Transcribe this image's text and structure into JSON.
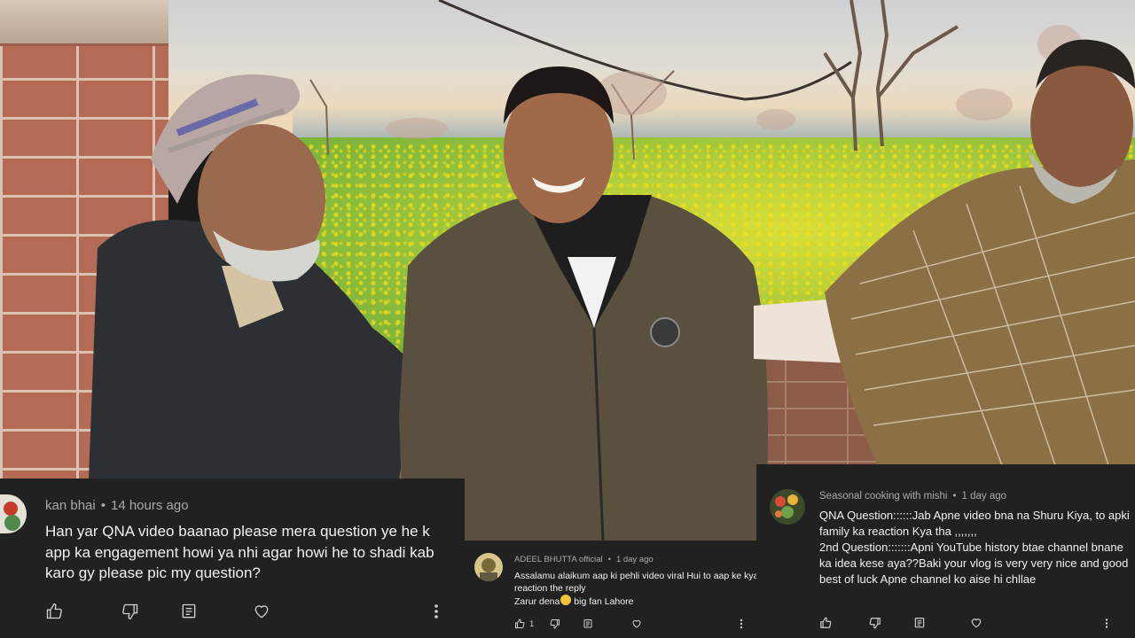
{
  "comments": [
    {
      "author": "kan bhai",
      "time": "14 hours ago",
      "text": "Han yar QNA video baanao please mera question ye he k app ka engagement howi ya nhi agar howi he to shadi kab karo gy please pic my question?",
      "like_count": "",
      "icons": [
        "thumbs-up-icon",
        "thumbs-down-icon",
        "reply-icon",
        "heart-icon",
        "more-vert-icon"
      ]
    },
    {
      "author": "ADEEL BHUTTA official",
      "time": "1 day ago",
      "text_line1": "Assalamu alaikum aap ki pehli video viral Hui to aap ke kya reaction the reply",
      "text_line2": "Zarur dena",
      "text_line3": " big fan Lahore",
      "like_count": "1",
      "icons": [
        "thumbs-up-icon",
        "thumbs-down-icon",
        "reply-icon",
        "heart-icon",
        "more-vert-icon"
      ]
    },
    {
      "author": "Seasonal cooking with mishi",
      "time": "1 day ago",
      "text_line1": "QNA Question::::::Jab Apne video bna na Shuru Kiya, to apki family ka reaction Kya tha ,,,,,,,",
      "text_line2": "2nd Question:::::::Apni YouTube history btae channel bnane ka idea kese aya??Baki your vlog is very very nice and good best of luck Apne channel ko aise hi chllae",
      "like_count": "",
      "icons": [
        "thumbs-up-icon",
        "thumbs-down-icon",
        "reply-icon",
        "heart-icon",
        "more-vert-icon"
      ]
    }
  ],
  "colors": {
    "card_bg": "#212121",
    "text": "#f1f1f1",
    "meta": "#aaaaaa",
    "mustard_field": "#c9d63a"
  }
}
